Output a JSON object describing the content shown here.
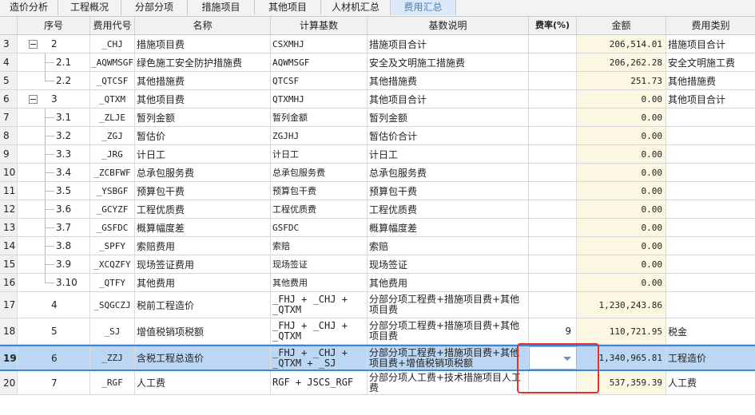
{
  "tabs": [
    {
      "label": "造价分析",
      "active": false
    },
    {
      "label": "工程概况",
      "active": false
    },
    {
      "label": "分部分项",
      "active": false
    },
    {
      "label": "措施项目",
      "active": false
    },
    {
      "label": "其他项目",
      "active": false
    },
    {
      "label": "人材机汇总",
      "active": false
    },
    {
      "label": "费用汇总",
      "active": true
    }
  ],
  "columns": {
    "seq": "序号",
    "code": "费用代号",
    "name": "名称",
    "basis": "计算基数",
    "desc": "基数说明",
    "rate": "费率(%)",
    "amount": "金额",
    "category": "费用类别"
  },
  "rows": [
    {
      "idx": "3",
      "seq": "2",
      "code": "_CHJ",
      "name": "措施项目费",
      "basis": "CSXMHJ",
      "desc": "措施项目合计",
      "rate": "",
      "amount": "206,514.01",
      "category": "措施项目合计",
      "toggle": true
    },
    {
      "idx": "4",
      "seq": "2.1",
      "code": "_AQWMSGF",
      "name": "绿色施工安全防护措施费",
      "basis": "AQWMSGF",
      "desc": "安全及文明施工措施费",
      "rate": "",
      "amount": "206,262.28",
      "category": "安全文明施工费"
    },
    {
      "idx": "5",
      "seq": "2.2",
      "code": "_QTCSF",
      "name": "其他措施费",
      "basis": "QTCSF",
      "desc": "其他措施费",
      "rate": "",
      "amount": "251.73",
      "category": "其他措施费"
    },
    {
      "idx": "6",
      "seq": "3",
      "code": "_QTXM",
      "name": "其他项目费",
      "basis": "QTXMHJ",
      "desc": "其他项目合计",
      "rate": "",
      "amount": "0.00",
      "category": "其他项目合计",
      "toggle": true
    },
    {
      "idx": "7",
      "seq": "3.1",
      "code": "_ZLJE",
      "name": "暂列金额",
      "basis": "暂列金额",
      "desc": "暂列金额",
      "rate": "",
      "amount": "0.00",
      "category": ""
    },
    {
      "idx": "8",
      "seq": "3.2",
      "code": "_ZGJ",
      "name": "暂估价",
      "basis": "ZGJHJ",
      "desc": "暂估价合计",
      "rate": "",
      "amount": "0.00",
      "category": ""
    },
    {
      "idx": "9",
      "seq": "3.3",
      "code": "_JRG",
      "name": "计日工",
      "basis": "计日工",
      "desc": "计日工",
      "rate": "",
      "amount": "0.00",
      "category": ""
    },
    {
      "idx": "10",
      "seq": "3.4",
      "code": "_ZCBFWF",
      "name": "总承包服务费",
      "basis": "总承包服务费",
      "desc": "总承包服务费",
      "rate": "",
      "amount": "0.00",
      "category": ""
    },
    {
      "idx": "11",
      "seq": "3.5",
      "code": "_YSBGF",
      "name": "预算包干费",
      "basis": "预算包干费",
      "desc": "预算包干费",
      "rate": "",
      "amount": "0.00",
      "category": ""
    },
    {
      "idx": "12",
      "seq": "3.6",
      "code": "_GCYZF",
      "name": "工程优质费",
      "basis": "工程优质费",
      "desc": "工程优质费",
      "rate": "",
      "amount": "0.00",
      "category": ""
    },
    {
      "idx": "13",
      "seq": "3.7",
      "code": "_GSFDC",
      "name": "概算幅度差",
      "basis": "GSFDC",
      "desc": "概算幅度差",
      "rate": "",
      "amount": "0.00",
      "category": ""
    },
    {
      "idx": "14",
      "seq": "3.8",
      "code": "_SPFY",
      "name": "索赔费用",
      "basis": "索赔",
      "desc": "索赔",
      "rate": "",
      "amount": "0.00",
      "category": ""
    },
    {
      "idx": "15",
      "seq": "3.9",
      "code": "_XCQZFY",
      "name": "现场签证费用",
      "basis": "现场签证",
      "desc": "现场签证",
      "rate": "",
      "amount": "0.00",
      "category": ""
    },
    {
      "idx": "16",
      "seq": "3.10",
      "code": "_QTFY",
      "name": "其他费用",
      "basis": "其他费用",
      "desc": "其他费用",
      "rate": "",
      "amount": "0.00",
      "category": ""
    },
    {
      "idx": "17",
      "seq": "4",
      "code": "_SQGCZJ",
      "name": "税前工程造价",
      "basis": "_FHJ + _CHJ + _QTXM",
      "desc": "分部分项工程费+措施项目费+其他项目费",
      "rate": "",
      "amount": "1,230,243.86",
      "category": ""
    },
    {
      "idx": "18",
      "seq": "5",
      "code": "_SJ",
      "name": "增值税销项税额",
      "basis": "_FHJ + _CHJ + _QTXM",
      "desc": "分部分项工程费+措施项目费+其他项目费",
      "rate": "9",
      "amount": "110,721.95",
      "category": "税金"
    },
    {
      "idx": "19",
      "seq": "6",
      "code": "_ZZJ",
      "name": "含税工程总造价",
      "basis": "_FHJ + _CHJ + _QTXM + _SJ",
      "desc": "分部分项工程费+措施项目费+其他项目费+增值税销项税额",
      "rate": "",
      "amount": "1,340,965.81",
      "category": "工程造价",
      "selected": true
    },
    {
      "idx": "20",
      "seq": "7",
      "code": "_RGF",
      "name": "人工费",
      "basis": "RGF + JSCS_RGF",
      "desc": "分部分项人工费+技术措施项目人工费",
      "rate": "",
      "amount": "537,359.39",
      "category": "人工费"
    }
  ],
  "colors": {
    "accent": "#3c86d6",
    "selected_row": "#bcd7f3",
    "amount_bg": "#fcf7e2",
    "highlight_box": "#e23232"
  },
  "icons": {
    "collapse": "minus-square-icon",
    "dropdown": "chevron-down-icon"
  }
}
